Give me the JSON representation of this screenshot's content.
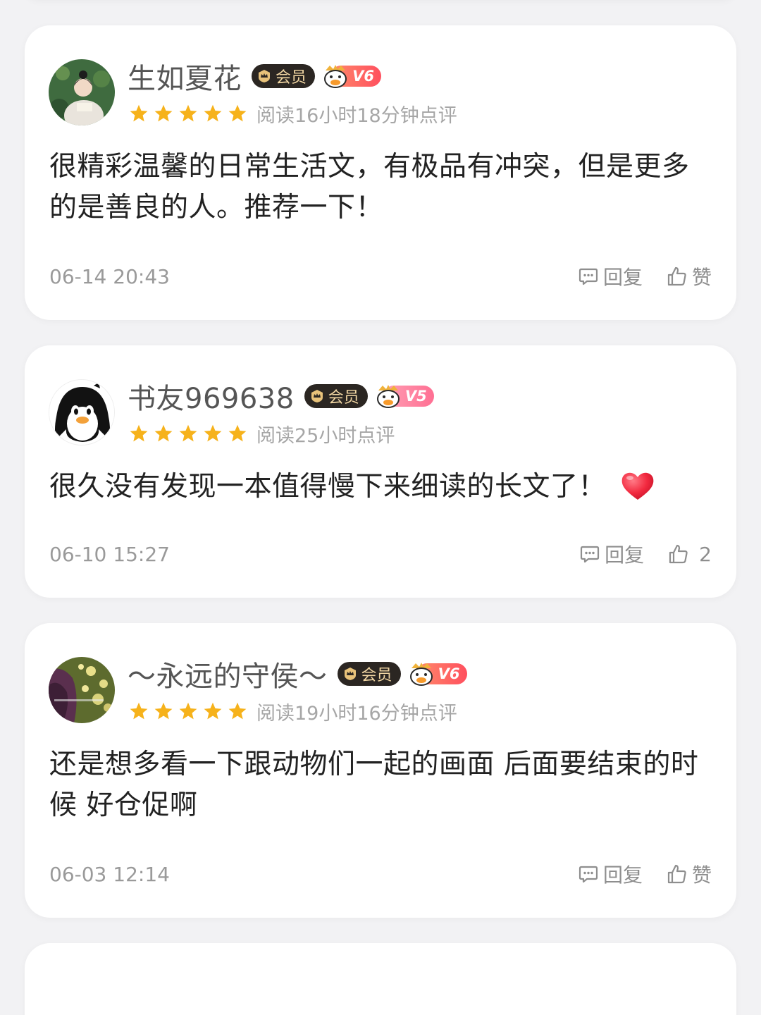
{
  "reviews": [
    {
      "username": "生如夏花",
      "vip_label": "会员",
      "level": "V6",
      "stars": 5,
      "read_time": "阅读16小时18分钟点评",
      "comment": "很精彩温馨的日常生活文，有极品有冲突，但是更多的是善良的人。推荐一下！",
      "date": "06-14 20:43",
      "reply_label": "回复",
      "like_label": "赞"
    },
    {
      "username": "书友969638",
      "vip_label": "会员",
      "level": "V5",
      "stars": 5,
      "read_time": "阅读25小时点评",
      "comment": "很久没有发现一本值得慢下来细读的长文了！",
      "comment_emoji": "heart-emoji",
      "date": "06-10 15:27",
      "reply_label": "回复",
      "like_label": "2"
    },
    {
      "username": "～永远的守侯～",
      "vip_label": "会员",
      "level": "V6",
      "stars": 5,
      "read_time": "阅读19小时16分钟点评",
      "comment": "还是想多看一下跟动物们一起的画面 后面要结束的时候 好仓促啊",
      "date": "06-03 12:14",
      "reply_label": "回复",
      "like_label": "赞"
    }
  ],
  "colors": {
    "star": "#f6b21b",
    "vip_bg": "#2b2622",
    "vip_text": "#f1d6a3",
    "level_gradient": [
      "#ff8a6b",
      "#ff4f5e"
    ],
    "heart": "#f2293f"
  },
  "icons": {
    "reply": "comment-bubble-icon",
    "like": "thumbs-up-icon",
    "vip": "crown-icon",
    "star": "star-icon"
  }
}
